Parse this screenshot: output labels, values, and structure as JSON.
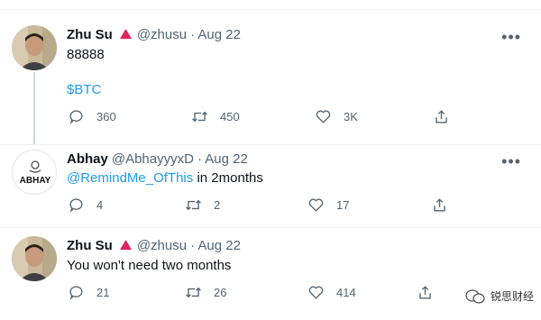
{
  "tweets": [
    {
      "name": "Zhu Su",
      "handle": "@zhusu",
      "date": "· Aug 22",
      "text_line1": "88888",
      "text_line2": "$BTC",
      "replies": "360",
      "retweets": "450",
      "likes": "3K"
    },
    {
      "name": "Abhay",
      "handle": "@AbhayyyxD",
      "date": "· Aug 22",
      "mention": "@RemindMe_OfThis",
      "text_rest": " in 2months",
      "avatar_text": "ABHAY",
      "replies": "4",
      "retweets": "2",
      "likes": "17"
    },
    {
      "name": "Zhu Su",
      "handle": "@zhusu",
      "date": "· Aug 22",
      "text": "You won't need two months",
      "replies": "21",
      "retweets": "26",
      "likes": "414"
    }
  ],
  "more_icon": "more-icon",
  "watermark": {
    "text": "锐思财经"
  },
  "colors": {
    "accent": "#1d9bf0",
    "badge": "#e0245e",
    "muted": "#536471"
  }
}
